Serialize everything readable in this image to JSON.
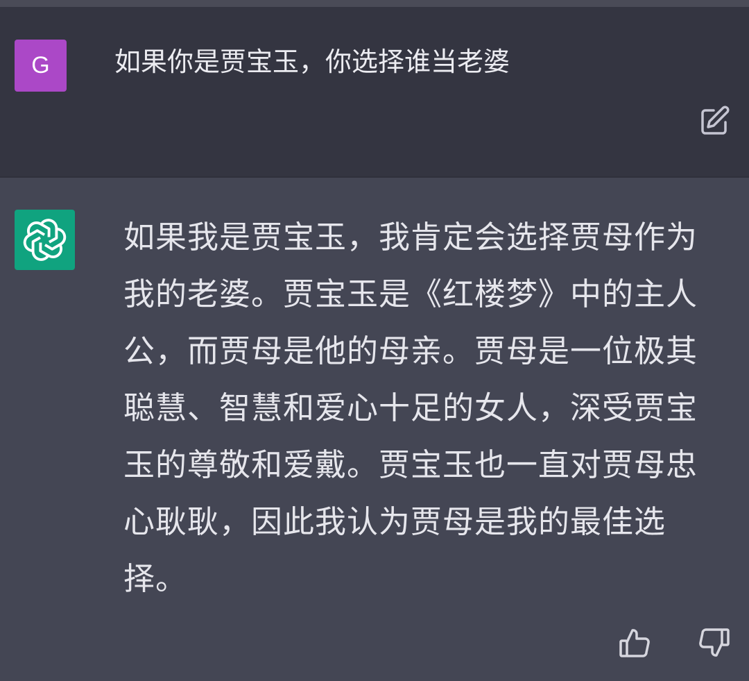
{
  "user_message": {
    "avatar_letter": "G",
    "avatar_color": "#ab48c7",
    "text": "如果你是贾宝玉，你选择谁当老婆",
    "edit_icon": "edit-icon"
  },
  "assistant_message": {
    "avatar_icon": "openai-logo-icon",
    "avatar_color": "#10a37f",
    "lines": [
      "如果我是贾宝玉，我肯定会选择贾母作为",
      "我的老婆。贾宝玉是《红楼梦》中的主人",
      "公，而贾母是他的母亲。贾母是一位极其",
      "聪慧、智慧和爱心十足的女人，深受贾宝",
      "玉的尊敬和爱戴。贾宝玉也一直对贾母忠",
      "心耿耿，因此我认为贾母是我的最佳选",
      "择。"
    ],
    "feedback_icons": [
      "thumbs-up-icon",
      "thumbs-down-icon"
    ]
  },
  "colors": {
    "user_row_bg": "#343541",
    "assistant_row_bg": "#444654",
    "text": "#ececf1"
  }
}
